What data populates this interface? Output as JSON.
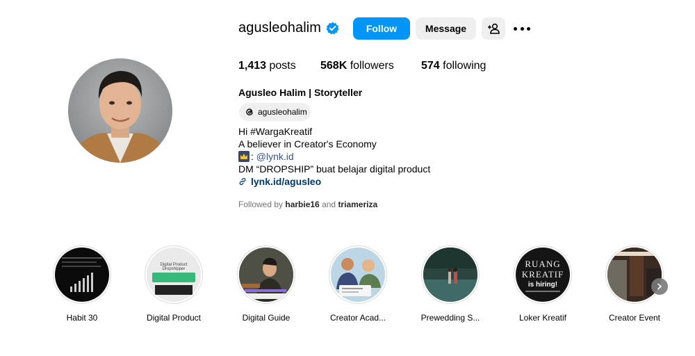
{
  "profile": {
    "username": "agusleohalim",
    "follow_label": "Follow",
    "message_label": "Message",
    "stats": {
      "posts_count": "1,413",
      "posts_label": "posts",
      "followers_count": "568K",
      "followers_label": "followers",
      "following_count": "574",
      "following_label": "following"
    },
    "full_name": "Agusleo Halim | Storyteller",
    "threads_handle": "agusleohalim",
    "bio": {
      "line1": "Hi #WargaKreatif",
      "line2": "A believer in Creator's Economy",
      "line3_prefix": ": ",
      "line3_mention": "@lynk.id",
      "line4": "DM “DROPSHIP” buat belajar digital product",
      "link": "lynk.id/agusleo"
    },
    "followed_by": {
      "prefix": "Followed by ",
      "user1": "harbie16",
      "joiner": " and ",
      "user2": "triameriza"
    }
  },
  "highlights": [
    {
      "label": "Habit 30"
    },
    {
      "label": "Digital Product",
      "thumb_text": "Digital Product Dropshipper"
    },
    {
      "label": "Digital Guide"
    },
    {
      "label": "Creator Acad..."
    },
    {
      "label": "Prewedding S..."
    },
    {
      "label": "Loker Kreatif",
      "thumb_line1": "RUANG",
      "thumb_line2": "KREATIF",
      "thumb_line3": "is hiring!"
    },
    {
      "label": "Creator Event"
    }
  ],
  "colors": {
    "follow_blue": "#0095f6",
    "verified_blue": "#0095f6",
    "secondary_button": "#efefef",
    "link_dark": "#00376b"
  }
}
